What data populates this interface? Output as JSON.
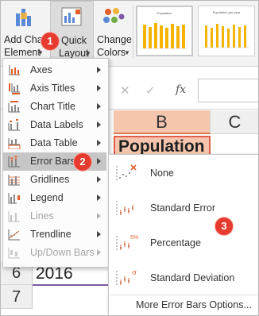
{
  "ribbon": {
    "add_chart_element": {
      "line1": "Add Chart",
      "line2": "Element"
    },
    "quick_layout": {
      "line1": "Quick",
      "line2": "Layout"
    },
    "change_colors": {
      "line1": "Change",
      "line2": "Colors"
    },
    "style_thumb_1_title": "Population",
    "style_thumb_2_title": "Population per year"
  },
  "badges": {
    "b1": "1",
    "b2": "2",
    "b3": "3"
  },
  "formula_bar": {
    "fx": "fx",
    "value": ""
  },
  "grid": {
    "col_b": "B",
    "col_c": "C",
    "b1_value": "Population",
    "rows": [
      "6",
      "7"
    ],
    "a6_value": "2016"
  },
  "menu": {
    "items": [
      {
        "label": "Axes",
        "icon": "axes-icon",
        "enabled": true
      },
      {
        "label": "Axis Titles",
        "icon": "axis-titles-icon",
        "enabled": true
      },
      {
        "label": "Chart Title",
        "icon": "chart-title-icon",
        "enabled": true
      },
      {
        "label": "Data Labels",
        "icon": "data-labels-icon",
        "enabled": true
      },
      {
        "label": "Data Table",
        "icon": "data-table-icon",
        "enabled": true
      },
      {
        "label": "Error Bars",
        "icon": "error-bars-icon",
        "enabled": true,
        "selected": true
      },
      {
        "label": "Gridlines",
        "icon": "gridlines-icon",
        "enabled": true
      },
      {
        "label": "Legend",
        "icon": "legend-icon",
        "enabled": true
      },
      {
        "label": "Lines",
        "icon": "lines-icon",
        "enabled": false
      },
      {
        "label": "Trendline",
        "icon": "trendline-icon",
        "enabled": true
      },
      {
        "label": "Up/Down Bars",
        "icon": "up-down-bars-icon",
        "enabled": false
      }
    ]
  },
  "submenu": {
    "items": [
      {
        "label": "None",
        "icon": "error-bars-none-icon"
      },
      {
        "label": "Standard Error",
        "icon": "error-bars-standard-error-icon"
      },
      {
        "label": "Percentage",
        "icon": "error-bars-percentage-icon",
        "badge": "5%"
      },
      {
        "label": "Standard Deviation",
        "icon": "error-bars-std-dev-icon",
        "badge": "σ"
      }
    ],
    "more": "More Error Bars Options..."
  },
  "colors": {
    "accent_orange": "#e15f2b",
    "badge_red": "#e63b2e",
    "header_selected": "#f5c6ad",
    "bar_yellow": "#f4b400"
  }
}
